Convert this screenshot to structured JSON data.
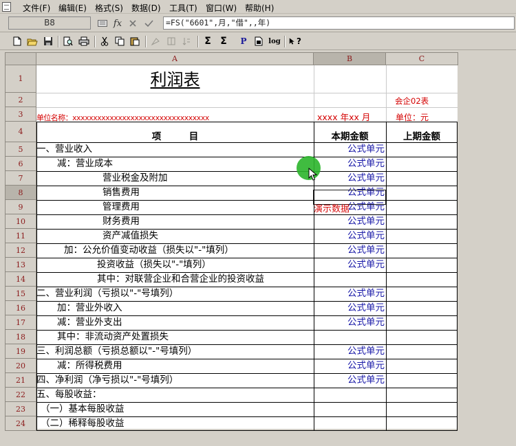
{
  "menu": [
    "文件(F)",
    "编辑(E)",
    "格式(S)",
    "数据(D)",
    "工具(T)",
    "窗口(W)",
    "帮助(H)"
  ],
  "formula_bar": {
    "cell_ref": "B8",
    "fx_label": "fx",
    "formula": "=FS(\"6601\",月,\"借\",,年)"
  },
  "toolbar_glyphs": {
    "sum": "Σ",
    "sum_cond": "Σ",
    "p": "P",
    "log": "log",
    "help": "?"
  },
  "columns": [
    "A",
    "B",
    "C"
  ],
  "rows": [
    "1",
    "2",
    "3",
    "4",
    "5",
    "6",
    "7",
    "8",
    "9",
    "10",
    "11",
    "12",
    "13",
    "14",
    "15",
    "16",
    "17",
    "18",
    "19",
    "20",
    "21",
    "22",
    "23",
    "24"
  ],
  "report": {
    "title": "利润表",
    "form_code": "会企02表",
    "unit_name_label": "单位名称：xxxxxxxxxxxxxxxxxxxxxxxxxxxxxxxxx",
    "period_label": "xxxx 年xx 月",
    "unit_label": "单位：元",
    "col_item": "项　　　目",
    "col_current": "本期金额",
    "col_previous": "上期金额",
    "demo_text": "演示数据"
  },
  "items": [
    {
      "label": "一、营业收入",
      "value": "公式单元"
    },
    {
      "label": "减：营业成本",
      "value": "公式单元"
    },
    {
      "label": "营业税金及附加",
      "value": "公式单元"
    },
    {
      "label": "销售费用",
      "value": "公式单元"
    },
    {
      "label": "管理费用",
      "value": "公式单元"
    },
    {
      "label": "财务费用",
      "value": "公式单元"
    },
    {
      "label": "资产减值损失",
      "value": "公式单元"
    },
    {
      "label": "加：公允价值变动收益（损失以\"-\"填列）",
      "value": "公式单元"
    },
    {
      "label": "投资收益（损失以\"-\"填列）",
      "value": "公式单元"
    },
    {
      "label": "其中：对联营企业和合营企业的投资收益",
      "value": ""
    },
    {
      "label": "二、营业利润（亏损以\"-\"号填列）",
      "value": "公式单元"
    },
    {
      "label": "加：营业外收入",
      "value": "公式单元"
    },
    {
      "label": "减：营业外支出",
      "value": "公式单元"
    },
    {
      "label": "其中：非流动资产处置损失",
      "value": ""
    },
    {
      "label": "三、利润总额（亏损总额以\"-\"号填列）",
      "value": "公式单元"
    },
    {
      "label": "减：所得税费用",
      "value": "公式单元"
    },
    {
      "label": "四、净利润（净亏损以\"-\"号填列）",
      "value": "公式单元"
    },
    {
      "label": "五、每股收益：",
      "value": ""
    },
    {
      "label": "（一）基本每股收益",
      "value": ""
    },
    {
      "label": "（二）稀释每股收益",
      "value": ""
    }
  ]
}
